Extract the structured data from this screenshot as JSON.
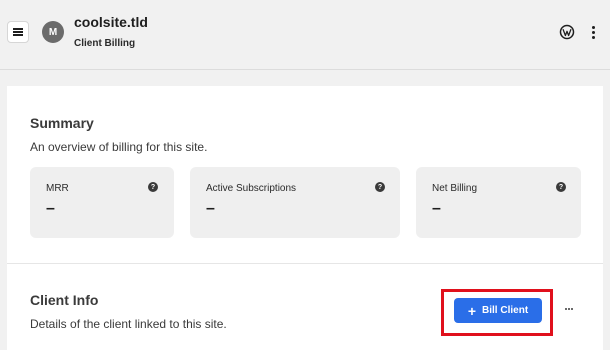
{
  "header": {
    "site_name": "coolsite.tld",
    "page_subtitle": "Client Billing",
    "avatar_initial": "M"
  },
  "summary": {
    "title": "Summary",
    "description": "An overview of billing for this site.",
    "stats": [
      {
        "label": "MRR",
        "value": "–",
        "help": "?"
      },
      {
        "label": "Active Subscriptions",
        "value": "–",
        "help": "?"
      },
      {
        "label": "Net Billing",
        "value": "–",
        "help": "?"
      }
    ]
  },
  "client_info": {
    "title": "Client Info",
    "description": "Details of the client linked to this site.",
    "bill_button_label": "Bill Client",
    "bill_button_icon": "+"
  },
  "colors": {
    "accent": "#2a6ee8",
    "highlight": "#e0101c",
    "background": "#f1f1f1",
    "card": "#ffffff",
    "stat_bg": "#efefef"
  },
  "icons": {
    "menu": "menu-icon",
    "wordpress": "wordpress-icon",
    "more_vertical": "more-vertical-icon",
    "more_horizontal": "more-horizontal-icon",
    "help": "help-icon"
  }
}
